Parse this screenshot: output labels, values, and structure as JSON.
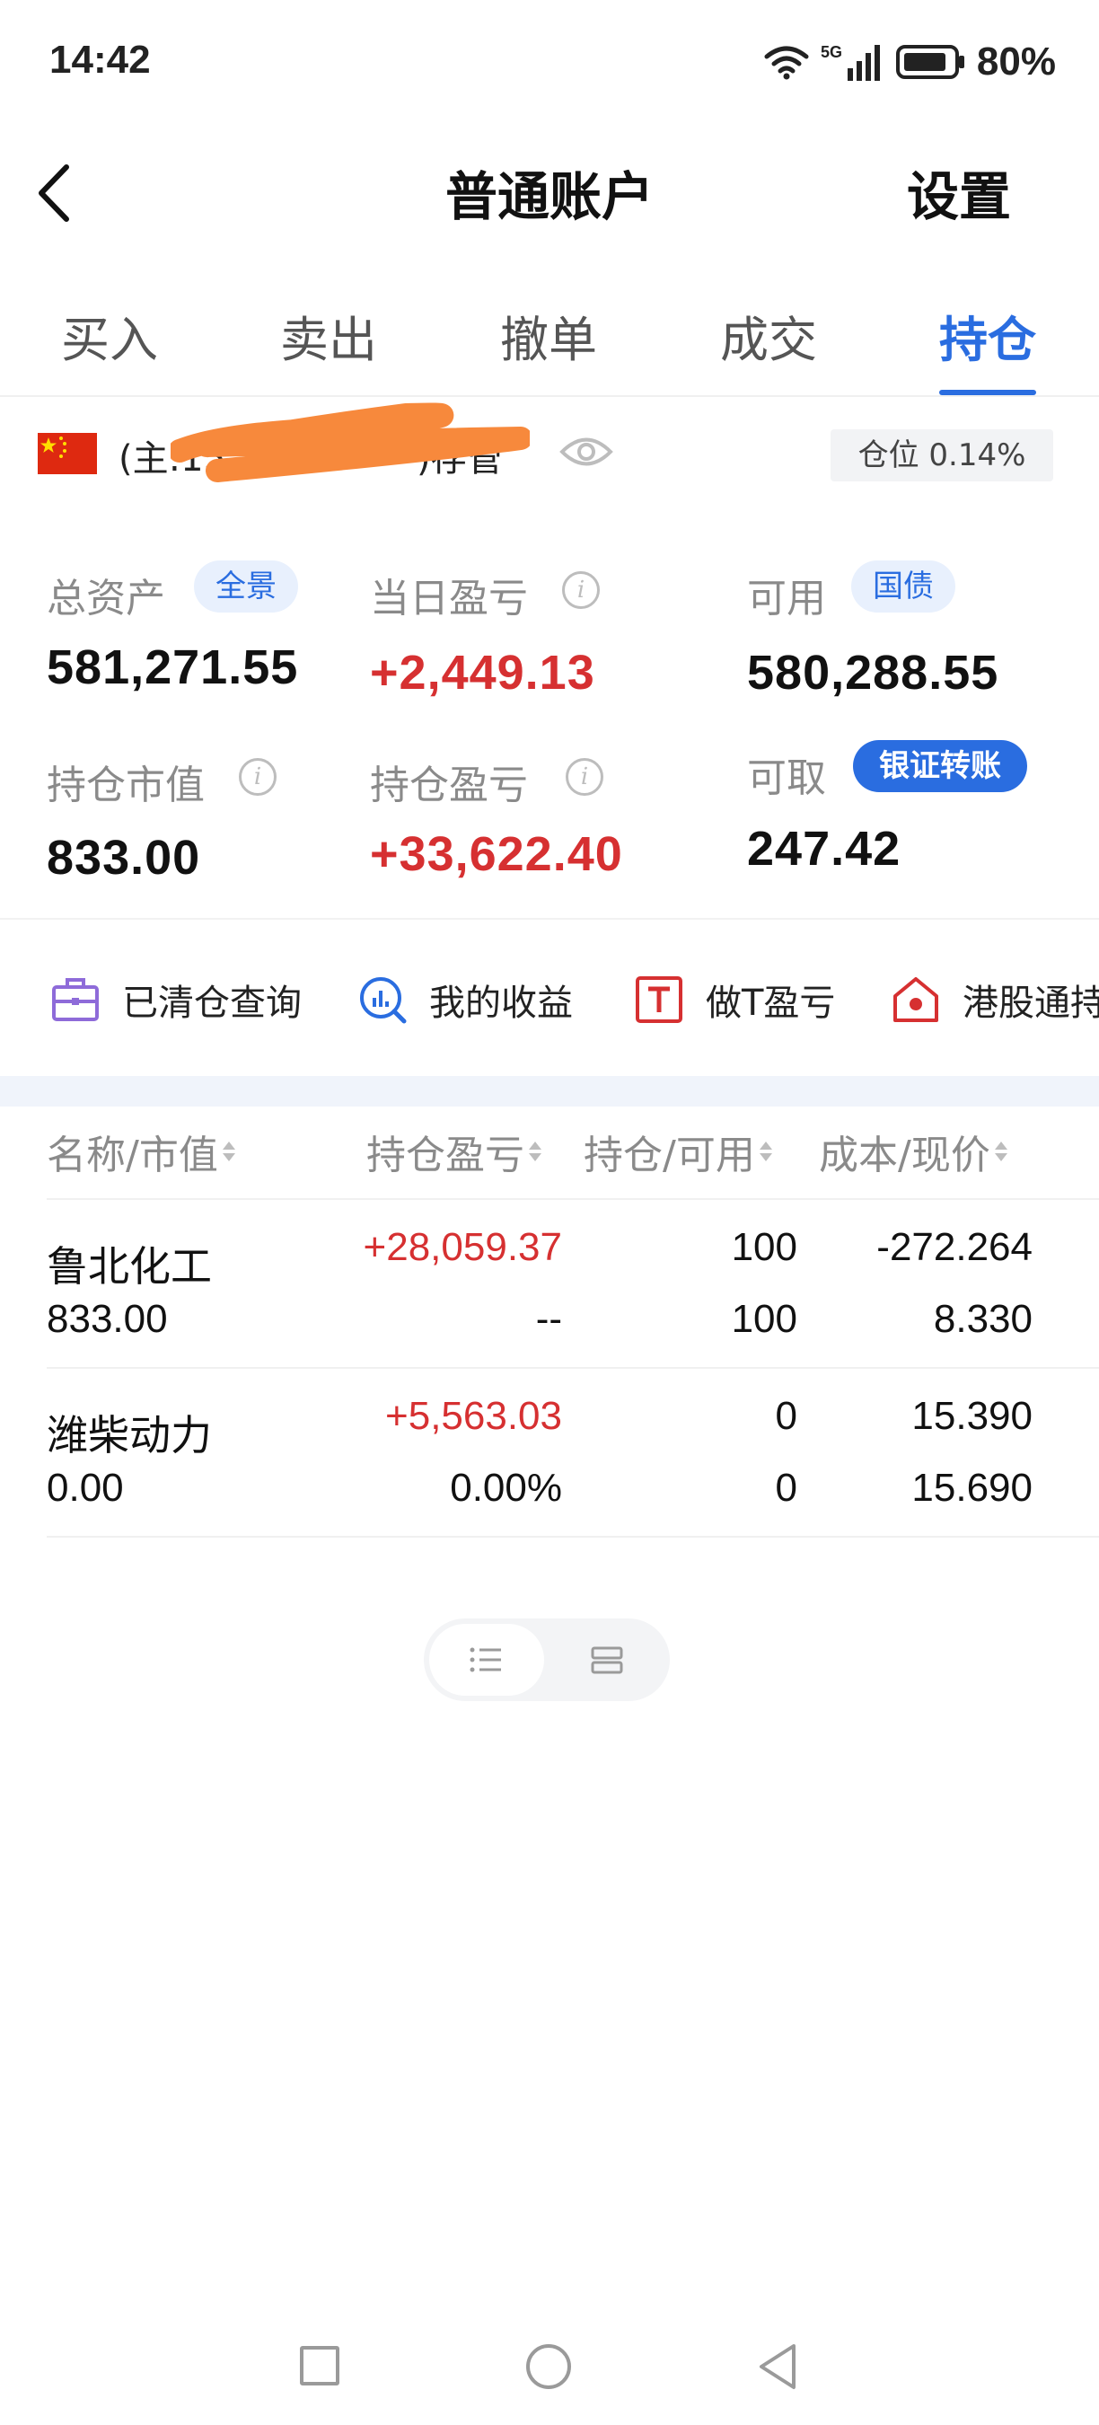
{
  "status_bar": {
    "time": "14:42",
    "network": "5G",
    "battery": "80%"
  },
  "header": {
    "title": "普通账户",
    "settings_label": "设置"
  },
  "tabs": [
    {
      "label": "买入",
      "active": false
    },
    {
      "label": "卖出",
      "active": false
    },
    {
      "label": "撤单",
      "active": false
    },
    {
      "label": "成交",
      "active": false
    },
    {
      "label": "持仓",
      "active": true
    }
  ],
  "account": {
    "label": "(主:15",
    "label_tail": ")存管",
    "position_badge": "仓位 0.14%"
  },
  "summary": {
    "total_assets": {
      "label": "总资产",
      "tag": "全景",
      "value": "581,271.55"
    },
    "daily_pnl": {
      "label": "当日盈亏",
      "value": "+2,449.13"
    },
    "available": {
      "label": "可用",
      "tag": "国债",
      "value": "580,288.55"
    },
    "market_value": {
      "label": "持仓市值",
      "value": "833.00"
    },
    "position_pnl": {
      "label": "持仓盈亏",
      "value": "+33,622.40"
    },
    "withdrawable": {
      "label": "可取",
      "tag": "银证转账",
      "value": "247.42"
    }
  },
  "quick_actions": [
    {
      "label": "已清仓查询",
      "icon": "briefcase-icon"
    },
    {
      "label": "我的收益",
      "icon": "chart-magnifier-icon"
    },
    {
      "label": "做T盈亏",
      "icon": "t-square-icon"
    },
    {
      "label": "港股通持",
      "icon": "hk-house-icon"
    }
  ],
  "table": {
    "headers": [
      "名称/市值",
      "持仓盈亏",
      "持仓/可用",
      "成本/现价"
    ],
    "rows": [
      {
        "name": "鲁北化工",
        "market_value": "833.00",
        "pnl": "+28,059.37",
        "pnl_pct": "--",
        "position": "100",
        "available": "100",
        "cost": "-272.264",
        "price": "8.330"
      },
      {
        "name": "潍柴动力",
        "market_value": "0.00",
        "pnl": "+5,563.03",
        "pnl_pct": "0.00%",
        "position": "0",
        "available": "0",
        "cost": "15.390",
        "price": "15.690"
      }
    ]
  },
  "colors": {
    "accent": "#2a6de0",
    "gain": "#d63031",
    "redaction": "#f7893c"
  }
}
